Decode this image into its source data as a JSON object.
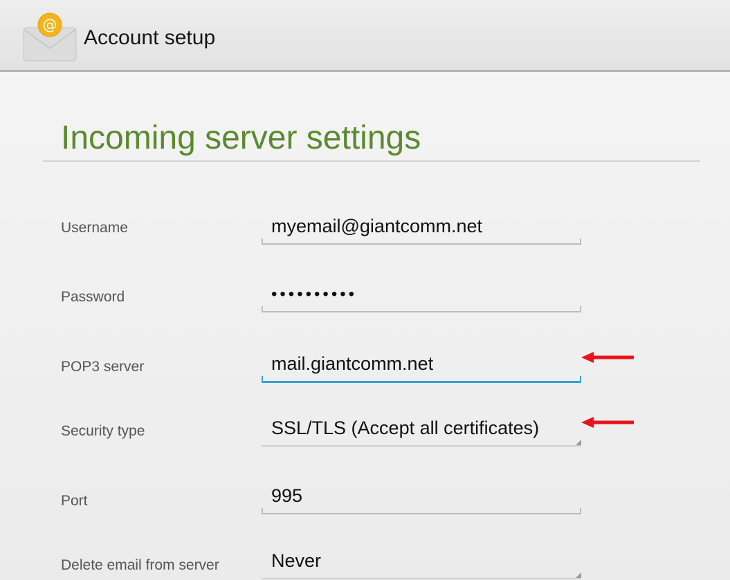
{
  "header": {
    "title": "Account setup",
    "icon": "email-at-envelope-icon"
  },
  "page": {
    "heading": "Incoming server settings"
  },
  "fields": {
    "username": {
      "label": "Username",
      "value": "myemail@giantcomm.net"
    },
    "password": {
      "label": "Password",
      "value": "••••••••••"
    },
    "pop3_server": {
      "label": "POP3 server",
      "value": "mail.giantcomm.net"
    },
    "security_type": {
      "label": "Security type",
      "value": "SSL/TLS (Accept all certificates)"
    },
    "port": {
      "label": "Port",
      "value": "995"
    },
    "delete_email": {
      "label": "Delete email from server",
      "value": "Never"
    }
  },
  "annotations": {
    "arrow_color": "#e8141a"
  },
  "colors": {
    "heading": "#5a8a2e",
    "focus": "#33a3d4"
  }
}
